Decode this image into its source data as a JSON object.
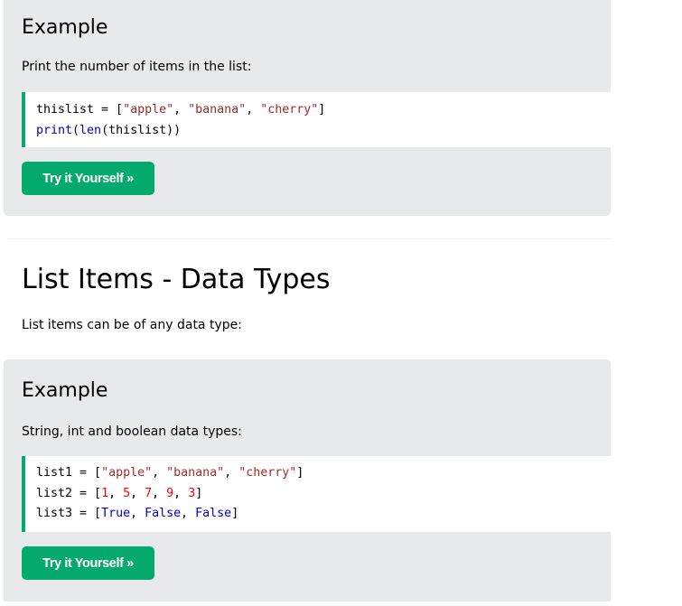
{
  "example1": {
    "heading": "Example",
    "description": "Print the number of items in the list:",
    "code_lines": [
      [
        {
          "t": "thislist = [",
          "c": "plain"
        },
        {
          "t": "\"apple\"",
          "c": "str"
        },
        {
          "t": ", ",
          "c": "plain"
        },
        {
          "t": "\"banana\"",
          "c": "str"
        },
        {
          "t": ", ",
          "c": "plain"
        },
        {
          "t": "\"cherry\"",
          "c": "str"
        },
        {
          "t": "]",
          "c": "plain"
        }
      ],
      [
        {
          "t": "print",
          "c": "fn"
        },
        {
          "t": "(",
          "c": "plain"
        },
        {
          "t": "len",
          "c": "fn"
        },
        {
          "t": "(thislist))",
          "c": "plain"
        }
      ]
    ],
    "button_label": "Try it Yourself »"
  },
  "section": {
    "title": "List Items - Data Types",
    "description": "List items can be of any data type:"
  },
  "example2": {
    "heading": "Example",
    "description": "String, int and boolean data types:",
    "code_lines": [
      [
        {
          "t": "list1 = [",
          "c": "plain"
        },
        {
          "t": "\"apple\"",
          "c": "str"
        },
        {
          "t": ", ",
          "c": "plain"
        },
        {
          "t": "\"banana\"",
          "c": "str"
        },
        {
          "t": ", ",
          "c": "plain"
        },
        {
          "t": "\"cherry\"",
          "c": "str"
        },
        {
          "t": "]",
          "c": "plain"
        }
      ],
      [
        {
          "t": "list2 = [",
          "c": "plain"
        },
        {
          "t": "1",
          "c": "num"
        },
        {
          "t": ", ",
          "c": "plain"
        },
        {
          "t": "5",
          "c": "num"
        },
        {
          "t": ", ",
          "c": "plain"
        },
        {
          "t": "7",
          "c": "num"
        },
        {
          "t": ", ",
          "c": "plain"
        },
        {
          "t": "9",
          "c": "num"
        },
        {
          "t": ", ",
          "c": "plain"
        },
        {
          "t": "3",
          "c": "num"
        },
        {
          "t": "]",
          "c": "plain"
        }
      ],
      [
        {
          "t": "list3 = [",
          "c": "plain"
        },
        {
          "t": "True",
          "c": "kw"
        },
        {
          "t": ", ",
          "c": "plain"
        },
        {
          "t": "False",
          "c": "kw"
        },
        {
          "t": ", ",
          "c": "plain"
        },
        {
          "t": "False",
          "c": "kw"
        },
        {
          "t": "]",
          "c": "plain"
        }
      ]
    ],
    "button_label": "Try it Yourself »"
  },
  "colors": {
    "example_bg": "#e7e9eb",
    "accent_green": "#04aa6d",
    "string": "#a52a2a",
    "number": "#ff0000",
    "keyword": "#0000cd"
  }
}
